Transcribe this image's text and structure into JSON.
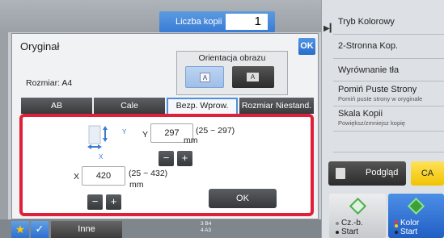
{
  "header": {
    "copies_label": "Liczba kopii",
    "copies_value": "1"
  },
  "right_panel": {
    "items": [
      {
        "label": "Tryb Kolorowy",
        "sub": ""
      },
      {
        "label": "2-Stronna Kop.",
        "sub": ""
      },
      {
        "label": "Wyrównanie tła",
        "sub": ""
      },
      {
        "label": "Pomiń Puste Strony",
        "sub": "Pomiń puste strony w oryginale"
      },
      {
        "label": "Skala Kopii",
        "sub": "Powiększ/zmniejsz kopię"
      }
    ],
    "preview_label": "Podgląd",
    "ca_label": "CA",
    "start_bw_label": "Cz.-b.",
    "start_bw_sub": "Start",
    "start_color_label": "Kolor",
    "start_color_sub": "Start"
  },
  "bottom": {
    "other_label": "Inne",
    "tray_rows": [
      "3  B4",
      "4  A3"
    ]
  },
  "dialog": {
    "title": "Oryginał",
    "ok_label": "OK",
    "orientation_label": "Orientacja obrazu",
    "orientation_a_glyph": "A",
    "orientation_b_glyph": "A",
    "size_label": "Rozmiar: A4",
    "tabs": [
      "AB",
      "Cale",
      "Bezp. Wprow.",
      "Rozmiar Niestand."
    ],
    "active_tab": "Bezp. Wprow.",
    "y_label": "Y",
    "y_value": "297",
    "y_range": "(25 ~ 297)",
    "y_unit": "mm",
    "x_label": "X",
    "x_value": "420",
    "x_range": "(25 ~ 432)",
    "x_unit": "mm",
    "icon_x": "X",
    "icon_y": "Y",
    "minus": "−",
    "plus": "+",
    "ok_button": "OK"
  }
}
